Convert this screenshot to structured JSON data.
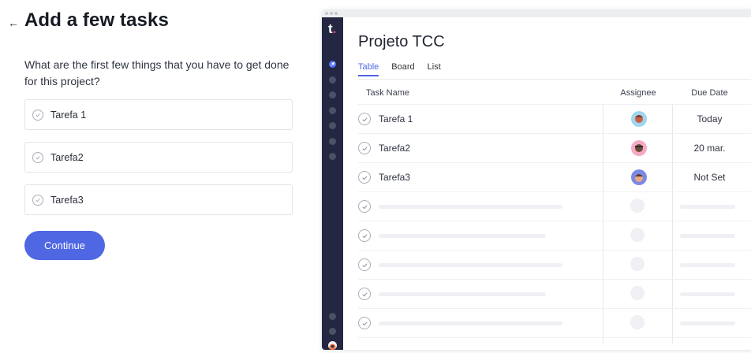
{
  "onboarding": {
    "back_symbol": "←",
    "heading": "Add a few tasks",
    "question": "What are the first few things that you have to get done for this project?",
    "tasks": [
      {
        "value": "Tarefa 1"
      },
      {
        "value": "Tarefa2"
      },
      {
        "value": "Tarefa3"
      }
    ],
    "continue_label": "Continue"
  },
  "preview": {
    "logo_letter": "t",
    "logo_dot": ".",
    "project_title": "Projeto TCC",
    "tabs": [
      {
        "label": "Table",
        "active": true
      },
      {
        "label": "Board",
        "active": false
      },
      {
        "label": "List",
        "active": false
      }
    ],
    "columns": {
      "name": "Task Name",
      "assignee": "Assignee",
      "due": "Due Date"
    },
    "rows": [
      {
        "name": "Tarefa 1",
        "due": "Today",
        "avatar": "avatar-blue"
      },
      {
        "name": "Tarefa2",
        "due": "20 mar.",
        "avatar": "avatar-pink"
      },
      {
        "name": "Tarefa3",
        "due": "Not Set",
        "avatar": "avatar-purple"
      }
    ],
    "placeholder_rows": 5
  },
  "colors": {
    "accent": "#4f67e3",
    "sidebar": "#232741",
    "logo_dot": "#ff3e7f"
  }
}
